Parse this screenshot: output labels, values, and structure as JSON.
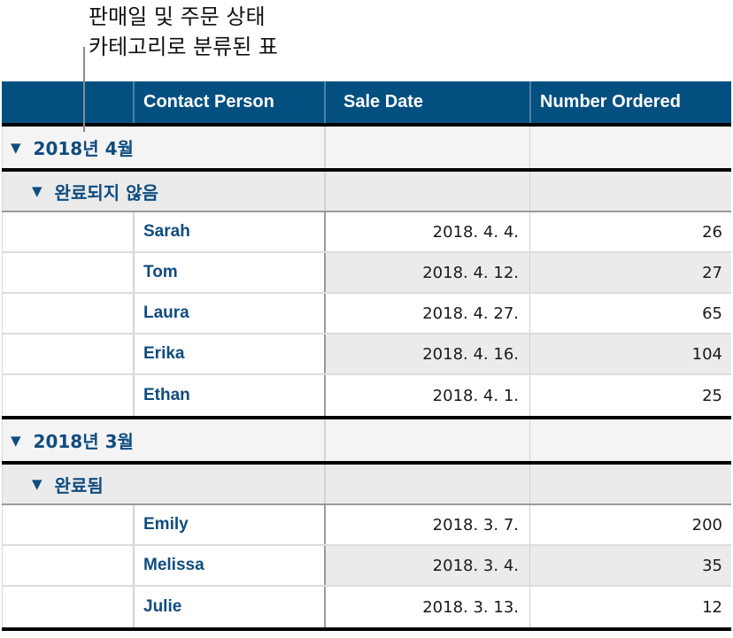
{
  "callout": {
    "line1": "판매일 및 주문 상태",
    "line2": "카테고리로 분류된 표"
  },
  "colors": {
    "header_bg": "#034f80",
    "header_text": "#ffffff",
    "label_text": "#0f4c7f",
    "group_bg": "#f4f4f4",
    "subgroup_bg": "#ebebeb"
  },
  "table": {
    "columns": [
      "",
      "Contact Person",
      "Sale Date",
      "Number Ordered"
    ],
    "groups": [
      {
        "label": "2018년 4월",
        "toggle_icon": "disclosure-triangle-down",
        "subgroups": [
          {
            "label": "완료되지 않음",
            "toggle_icon": "disclosure-triangle-down",
            "rows": [
              {
                "contact": "Sarah",
                "date": "2018. 4. 4.",
                "number": "26"
              },
              {
                "contact": "Tom",
                "date": "2018. 4. 12.",
                "number": "27"
              },
              {
                "contact": "Laura",
                "date": "2018. 4. 27.",
                "number": "65"
              },
              {
                "contact": "Erika",
                "date": "2018. 4. 16.",
                "number": "104"
              },
              {
                "contact": "Ethan",
                "date": "2018. 4. 1.",
                "number": "25"
              }
            ]
          }
        ]
      },
      {
        "label": "2018년 3월",
        "toggle_icon": "disclosure-triangle-down",
        "subgroups": [
          {
            "label": "완료됨",
            "toggle_icon": "disclosure-triangle-down",
            "rows": [
              {
                "contact": "Emily",
                "date": "2018. 3. 7.",
                "number": "200"
              },
              {
                "contact": "Melissa",
                "date": "2018. 3. 4.",
                "number": "35"
              },
              {
                "contact": "Julie",
                "date": "2018. 3. 13.",
                "number": "12"
              }
            ]
          }
        ]
      }
    ]
  }
}
